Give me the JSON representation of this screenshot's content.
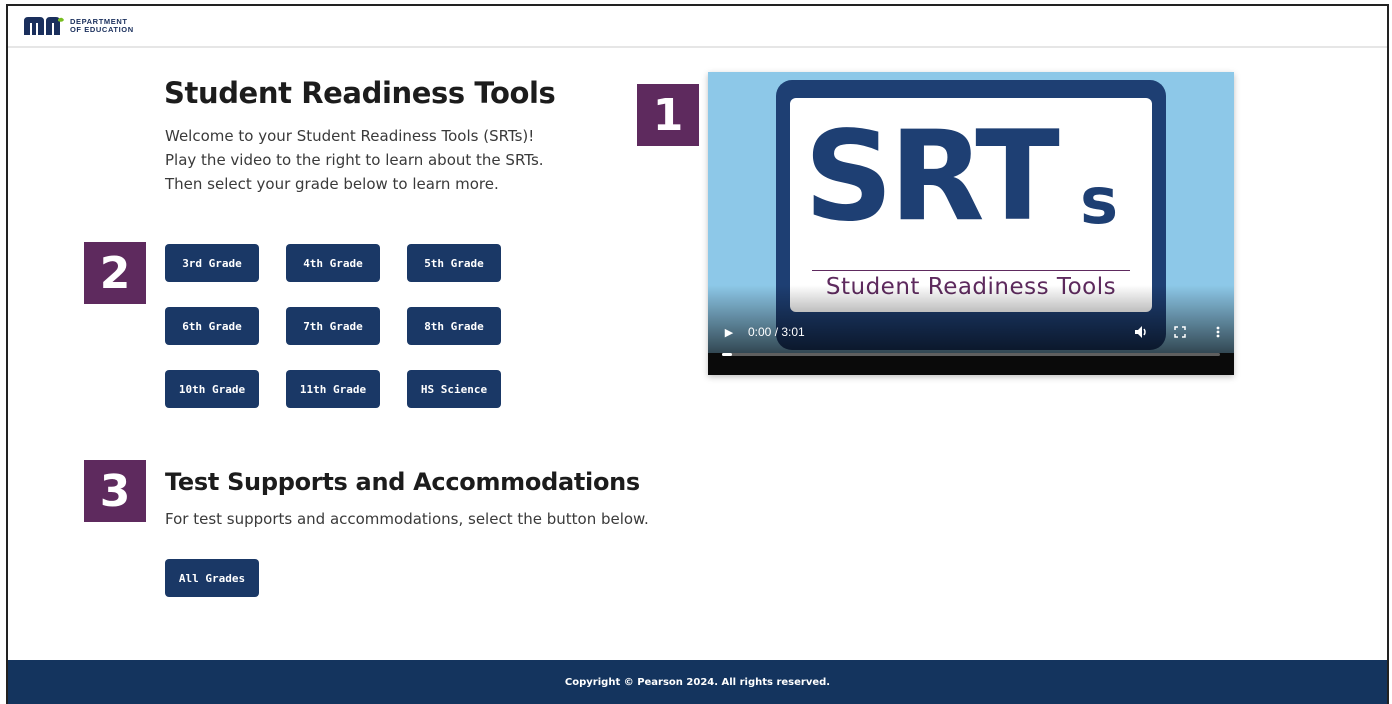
{
  "header": {
    "logo_line1": "DEPARTMENT",
    "logo_line2": "OF EDUCATION",
    "brand_color": "#1a2f5c",
    "accent_color": "#78be20"
  },
  "main": {
    "title": "Student Readiness Tools",
    "intro_lines": [
      "Welcome to your Student Readiness Tools (SRTs)!",
      "Play the video to the right to learn about the SRTs.",
      "Then select your grade below to learn more."
    ],
    "step_badges": [
      "1",
      "2",
      "3"
    ],
    "grade_buttons": [
      "3rd Grade",
      "4th Grade",
      "5th Grade",
      "6th Grade",
      "7th Grade",
      "8th Grade",
      "10th Grade",
      "11th Grade",
      "HS Science"
    ],
    "supports": {
      "title": "Test Supports and Accommodations",
      "description": "For test supports and accommodations, select the button below.",
      "button_label": "All Grades"
    }
  },
  "video": {
    "poster_title": "SRT",
    "poster_title_suffix": "s",
    "poster_subtitle": "Student Readiness Tools",
    "time_display": "0:00 / 3:01",
    "progress_fraction": 0.02,
    "icons": [
      "play-icon",
      "volume-icon",
      "fullscreen-icon",
      "more-options-icon"
    ]
  },
  "footer": {
    "copyright": "Copyright © Pearson 2024. All rights reserved."
  },
  "colors": {
    "button_bg": "#1a3866",
    "badge_bg": "#5e2a5e",
    "footer_bg": "#14345e"
  }
}
